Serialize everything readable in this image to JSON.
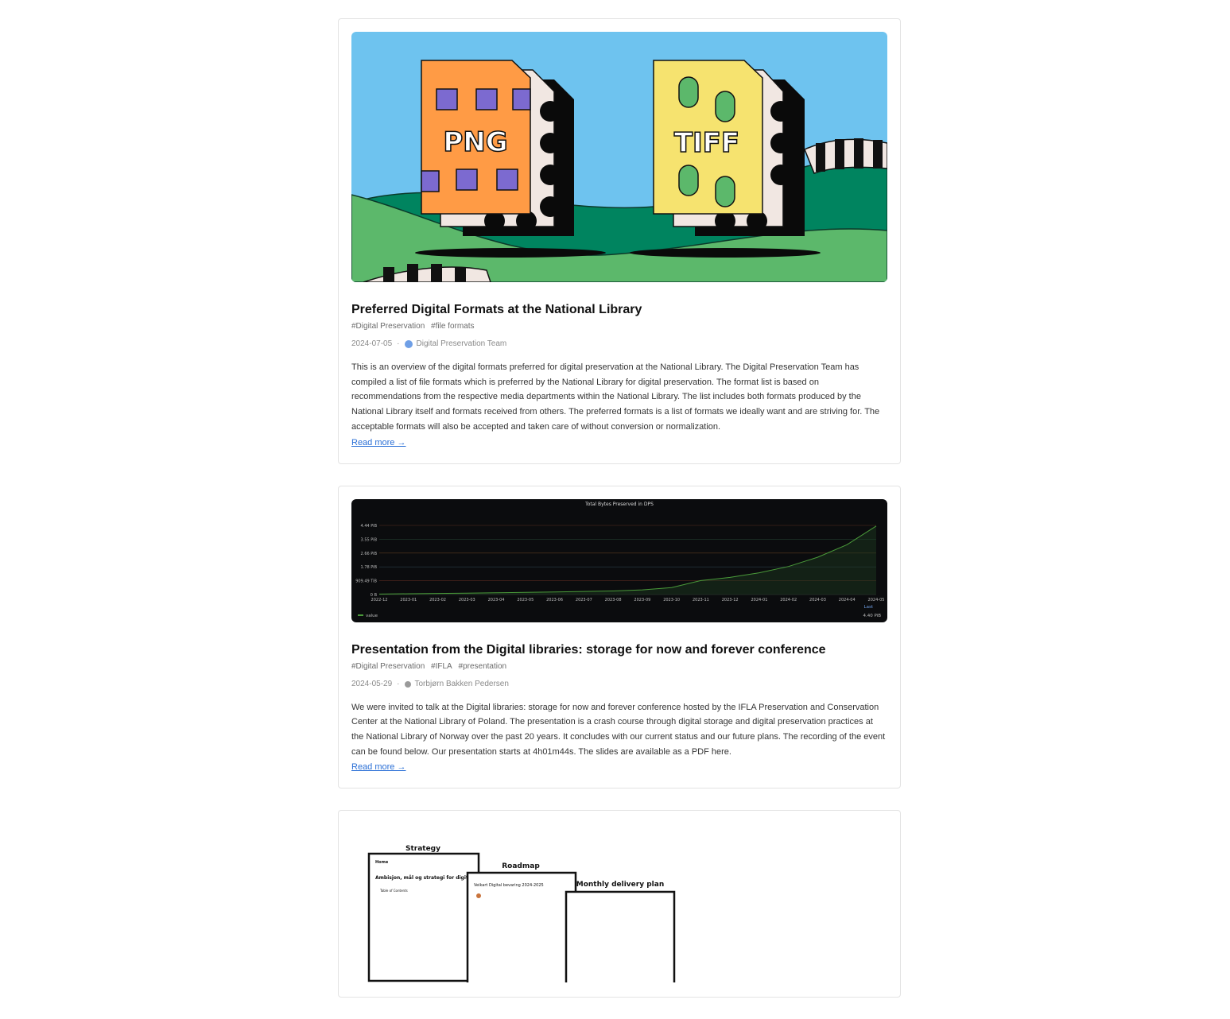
{
  "posts": [
    {
      "title": "Preferred Digital Formats at the National Library",
      "tags": [
        "#Digital Preservation",
        "#file formats"
      ],
      "date": "2024-07-05",
      "author": "Digital Preservation Team",
      "description": "This is an overview of the digital formats preferred for digital preservation at the National Library. The Digital Preservation Team has compiled a list of file formats which is preferred by the National Library for digital preservation. The format list is based on recommendations from the respective media departments within the National Library. The list includes both formats produced by the National Library itself and formats received from others. The preferred formats is a list of formats we ideally want and are striving for. The acceptable formats will also be accepted and taken care of without conversion or normalization.",
      "read_more": "Read more →",
      "image": {
        "left_file_label": "PNG",
        "right_file_label": "TIFF"
      }
    },
    {
      "title": "Presentation from the Digital libraries: storage for now and forever conference",
      "tags": [
        "#Digital Preservation",
        "#IFLA",
        "#presentation"
      ],
      "date": "2024-05-29",
      "author": "Torbjørn Bakken Pedersen",
      "description": "We were invited to talk at the Digital libraries: storage for now and forever conference hosted by the IFLA Preservation and Conservation Center at the National Library of Poland. The presentation is a crash course through digital storage and digital preservation practices at the National Library of Norway over the past 20 years. It concludes with our current status and our future plans. The recording of the event can be found below. Our presentation starts at 4h01m44s. The slides are available as a PDF here.",
      "read_more": "Read more →"
    },
    {
      "image": {
        "labels": [
          "Strategy",
          "Roadmap",
          "Monthly delivery plan"
        ],
        "doc1_nav": "Home",
        "doc1_heading": "Ambisjon, mål og strategi for digital bevaring",
        "doc1_toc": "Table of Contents",
        "doc2_heading": "Veikart Digital bevaring 2024-2025"
      }
    }
  ],
  "colors": {
    "link": "#2a6fd6",
    "sky": "#6ec3ef",
    "hill": "#00845f",
    "hill_light": "#5cb86b",
    "png_file": "#ff9b45",
    "tiff_file": "#f6e36f",
    "window": "#7c6ad0"
  },
  "chart_data": {
    "type": "area",
    "title": "Total Bytes Preserved in DPS",
    "x": [
      "2022-12",
      "2023-01",
      "2023-02",
      "2023-03",
      "2023-04",
      "2023-05",
      "2023-06",
      "2023-07",
      "2023-08",
      "2023-09",
      "2023-10",
      "2023-11",
      "2023-12",
      "2024-01",
      "2024-02",
      "2024-03",
      "2024-04",
      "2024-05"
    ],
    "y_tick_labels": [
      "0 B",
      "909.49 TiB",
      "1.78 PiB",
      "2.66 PiB",
      "3.55 PiB",
      "4.44 PiB"
    ],
    "ylim_pib": [
      0,
      4.44
    ],
    "series": [
      {
        "name": "value",
        "unit": "PiB",
        "values": [
          0.03,
          0.05,
          0.07,
          0.09,
          0.11,
          0.14,
          0.17,
          0.2,
          0.23,
          0.3,
          0.45,
          0.9,
          1.1,
          1.4,
          1.8,
          2.4,
          3.2,
          4.4
        ]
      }
    ],
    "legend": {
      "position": "bottom-left",
      "label": "value",
      "stat_label": "Last",
      "stat_value": "4.40 PiB"
    },
    "grid": true
  }
}
